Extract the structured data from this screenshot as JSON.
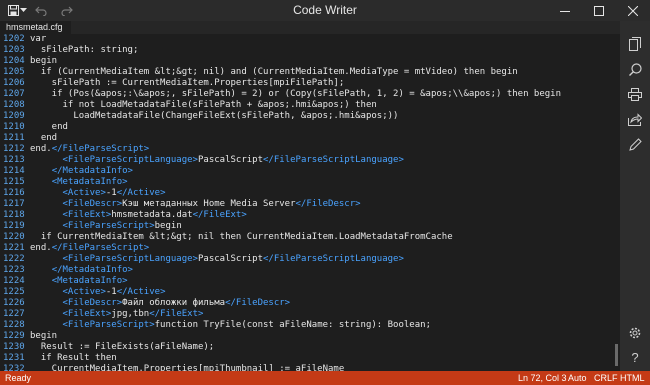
{
  "window": {
    "title": "Code Writer"
  },
  "tabs": [
    {
      "label": "hmsmetad.cfg"
    }
  ],
  "editor": {
    "lines": [
      {
        "num": "1202",
        "parts": [
          {
            "t": "var"
          }
        ]
      },
      {
        "num": "1203",
        "parts": [
          {
            "t": "  sFilePath: string;"
          }
        ]
      },
      {
        "num": "1204",
        "parts": [
          {
            "t": "begin"
          }
        ]
      },
      {
        "num": "1205",
        "parts": [
          {
            "t": "  if (CurrentMediaItem &lt;&gt; nil) and (CurrentMediaItem.MediaType = mtVideo) then begin"
          }
        ]
      },
      {
        "num": "1206",
        "parts": [
          {
            "t": "    sFilePath := CurrentMediaItem.Properties[mpiFilePath];"
          }
        ]
      },
      {
        "num": "1207",
        "parts": [
          {
            "t": "    if (Pos(&apos;:\\&apos;, sFilePath) = 2) or (Copy(sFilePath, 1, 2) = &apos;\\\\&apos;) then begin"
          }
        ]
      },
      {
        "num": "1208",
        "parts": [
          {
            "t": "      if not LoadMetadataFile(sFilePath + &apos;.hmi&apos;) then"
          }
        ]
      },
      {
        "num": "1209",
        "parts": [
          {
            "t": "        LoadMetadataFile(ChangeFileExt(sFilePath, &apos;.hmi&apos;))"
          }
        ]
      },
      {
        "num": "1210",
        "parts": [
          {
            "t": "    end"
          }
        ]
      },
      {
        "num": "1211",
        "parts": [
          {
            "t": "  end"
          }
        ]
      },
      {
        "num": "1212",
        "parts": [
          {
            "t": "end."
          },
          {
            "t": "</FileParseScript>",
            "tag": true
          }
        ]
      },
      {
        "num": "1213",
        "parts": [
          {
            "t": "      "
          },
          {
            "t": "<FileParseScriptLanguage>",
            "tag": true
          },
          {
            "t": "PascalScript"
          },
          {
            "t": "</FileParseScriptLanguage>",
            "tag": true
          }
        ]
      },
      {
        "num": "1214",
        "parts": [
          {
            "t": "    "
          },
          {
            "t": "</MetadataInfo>",
            "tag": true
          }
        ]
      },
      {
        "num": "1215",
        "parts": [
          {
            "t": "    "
          },
          {
            "t": "<MetadataInfo>",
            "tag": true
          }
        ]
      },
      {
        "num": "1216",
        "parts": [
          {
            "t": "      "
          },
          {
            "t": "<Active>",
            "tag": true
          },
          {
            "t": "-1"
          },
          {
            "t": "</Active>",
            "tag": true
          }
        ]
      },
      {
        "num": "1217",
        "parts": [
          {
            "t": "      "
          },
          {
            "t": "<FileDescr>",
            "tag": true
          },
          {
            "t": "Кэш метаданных Home Media Server"
          },
          {
            "t": "</FileDescr>",
            "tag": true
          }
        ]
      },
      {
        "num": "1218",
        "parts": [
          {
            "t": "      "
          },
          {
            "t": "<FileExt>",
            "tag": true
          },
          {
            "t": "hmsmetadata.dat"
          },
          {
            "t": "</FileExt>",
            "tag": true
          }
        ]
      },
      {
        "num": "1219",
        "parts": [
          {
            "t": "      "
          },
          {
            "t": "<FileParseScript>",
            "tag": true
          },
          {
            "t": "begin"
          }
        ]
      },
      {
        "num": "1220",
        "parts": [
          {
            "t": "  if CurrentMediaItem &lt;&gt; nil then CurrentMediaItem.LoadMetadataFromCache"
          }
        ]
      },
      {
        "num": "1221",
        "parts": [
          {
            "t": "end."
          },
          {
            "t": "</FileParseScript>",
            "tag": true
          }
        ]
      },
      {
        "num": "1222",
        "parts": [
          {
            "t": "      "
          },
          {
            "t": "<FileParseScriptLanguage>",
            "tag": true
          },
          {
            "t": "PascalScript"
          },
          {
            "t": "</FileParseScriptLanguage>",
            "tag": true
          }
        ]
      },
      {
        "num": "1223",
        "parts": [
          {
            "t": "    "
          },
          {
            "t": "</MetadataInfo>",
            "tag": true
          }
        ]
      },
      {
        "num": "1224",
        "parts": [
          {
            "t": "    "
          },
          {
            "t": "<MetadataInfo>",
            "tag": true
          }
        ]
      },
      {
        "num": "1225",
        "parts": [
          {
            "t": "      "
          },
          {
            "t": "<Active>",
            "tag": true
          },
          {
            "t": "-1"
          },
          {
            "t": "</Active>",
            "tag": true
          }
        ]
      },
      {
        "num": "1226",
        "parts": [
          {
            "t": "      "
          },
          {
            "t": "<FileDescr>",
            "tag": true
          },
          {
            "t": "Файл обложки фильма"
          },
          {
            "t": "</FileDescr>",
            "tag": true
          }
        ]
      },
      {
        "num": "1227",
        "parts": [
          {
            "t": "      "
          },
          {
            "t": "<FileExt>",
            "tag": true
          },
          {
            "t": "jpg,tbn"
          },
          {
            "t": "</FileExt>",
            "tag": true
          }
        ]
      },
      {
        "num": "1228",
        "parts": [
          {
            "t": "      "
          },
          {
            "t": "<FileParseScript>",
            "tag": true
          },
          {
            "t": "function TryFile(const aFileName: string): Boolean;"
          }
        ]
      },
      {
        "num": "1229",
        "parts": [
          {
            "t": "begin"
          }
        ]
      },
      {
        "num": "1230",
        "parts": [
          {
            "t": "  Result := FileExists(aFileName);"
          }
        ]
      },
      {
        "num": "1231",
        "parts": [
          {
            "t": "  if Result then"
          }
        ]
      },
      {
        "num": "1232",
        "parts": [
          {
            "t": "    CurrentMediaItem.Properties[mpiThumbnail] := aFileName"
          }
        ]
      }
    ]
  },
  "status": {
    "state": "Ready",
    "position": "Ln 72, Col 3",
    "auto": "Auto",
    "eol": "CRLF",
    "language": "HTML"
  },
  "colors": {
    "status_bar": "#c43a16",
    "line_number": "#5ea6ea",
    "xml_tag": "#4aa3ff",
    "editor_bg": "#1e1e1e"
  },
  "icons": {
    "titlebar": [
      "save-icon",
      "dropdown-icon",
      "undo-icon",
      "redo-icon"
    ],
    "window": [
      "minimize-icon",
      "maximize-icon",
      "close-icon"
    ],
    "sidebar": [
      "copy-icon",
      "search-icon",
      "print-icon",
      "share-icon",
      "edit-icon",
      "settings-icon",
      "help-icon"
    ]
  }
}
